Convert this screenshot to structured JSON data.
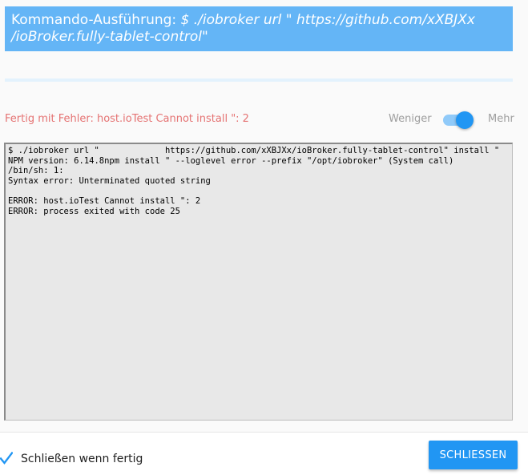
{
  "dialog": {
    "title_prefix": "Kommando-Ausführung: ",
    "title_command": "$ ./iobroker url \" https://github.com/xXBJXx /ioBroker.fully-tablet-control\"",
    "status_text": "Fertig mit Fehler: host.ioTest Cannot install \": 2",
    "toggle": {
      "less_label": "Weniger",
      "more_label": "Mehr",
      "checked": true
    },
    "log_lines": [
      "$ ./iobroker url \"             https://github.com/xXBJXx/ioBroker.fully-tablet-control\" install \"",
      "NPM version: 6.14.8npm install \" --loglevel error --prefix \"/opt/iobroker\" (System call)",
      "/bin/sh: 1:",
      "Syntax error: Unterminated quoted string",
      "",
      "ERROR: host.ioTest Cannot install \": 2",
      "ERROR: process exited with code 25"
    ],
    "footer": {
      "close_when_done_label": "Schließen wenn fertig",
      "close_when_done_checked": true,
      "close_button_label": "SCHLIESSEN"
    }
  },
  "colors": {
    "title_bg": "#64b5f6",
    "accent": "#2196f3",
    "error_text": "#e57373",
    "log_bg": "#e8e8e8"
  },
  "icons": {
    "checkbox": "checkmark-icon"
  }
}
